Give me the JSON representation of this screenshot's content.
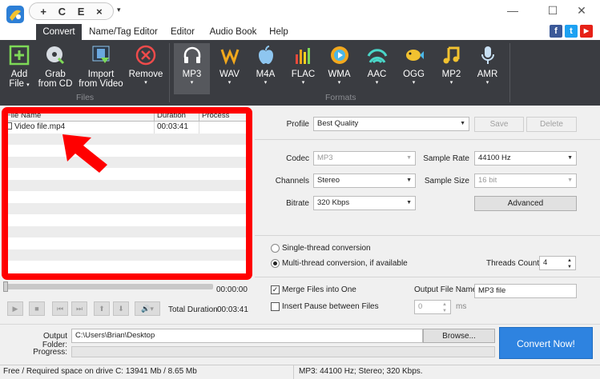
{
  "window": {
    "controls": [
      "—",
      "☐",
      "✕"
    ]
  },
  "quick_access": {
    "items": [
      "+",
      "C",
      "E",
      "×"
    ],
    "more": "▾"
  },
  "tabs": [
    "Convert",
    "Name/Tag Editor",
    "Editor",
    "Audio Book",
    "Help"
  ],
  "social": {
    "facebook": "f",
    "twitter": "t",
    "youtube": "▶"
  },
  "ribbon": {
    "files_group": "Files",
    "formats_group": "Formats",
    "add_file": [
      "Add",
      "File"
    ],
    "grab_from_cd": [
      "Grab",
      "from CD"
    ],
    "import_from_video": [
      "Import",
      "from Video"
    ],
    "remove": "Remove",
    "dropdown_arrow": "▾",
    "formats": [
      "MP3",
      "WAV",
      "M4A",
      "FLAC",
      "WMA",
      "AAC",
      "OGG",
      "MP2",
      "AMR"
    ]
  },
  "file_list": {
    "columns": [
      "File Name",
      "Duration",
      "Process"
    ],
    "rows": [
      {
        "name": "Video file.mp4",
        "duration": "00:03:41",
        "process": ""
      }
    ]
  },
  "settings": {
    "profile_label": "Profile",
    "profile_value": "Best Quality",
    "save_label": "Save",
    "delete_label": "Delete",
    "codec_label": "Codec",
    "codec_value": "MP3",
    "channels_label": "Channels",
    "channels_value": "Stereo",
    "bitrate_label": "Bitrate",
    "bitrate_value": "320 Kbps",
    "sample_rate_label": "Sample Rate",
    "sample_rate_value": "44100 Hz",
    "sample_size_label": "Sample Size",
    "sample_size_value": "16 bit",
    "advanced_label": "Advanced",
    "single_thread_label": "Single-thread conversion",
    "multi_thread_label": "Multi-thread conversion, if available",
    "threads_count_label": "Threads Count",
    "threads_count_value": "4",
    "merge_label": "Merge Files into One",
    "merge_checked": true,
    "insert_pause_label": "Insert Pause between Files",
    "insert_pause_checked": false,
    "output_file_name_label": "Output File Name",
    "output_file_name_value": "MP3 file",
    "pause_value": "0",
    "pause_unit": "ms"
  },
  "player": {
    "position": "00:00:00",
    "total_duration_label": "Total Duration",
    "total_duration_value": "00:03:41",
    "icons": [
      "▶",
      "■",
      "⏮",
      "⏭",
      "⬆",
      "⬇",
      "🔊▾"
    ]
  },
  "output": {
    "folder_label": "Output Folder:",
    "folder_value": "C:\\Users\\Brian\\Desktop",
    "browse_label": "Browse...",
    "progress_label": "Progress:",
    "convert_now_label": "Convert Now!"
  },
  "status": {
    "space": "Free / Required space on drive  C: 13941 Mb / 8.65 Mb",
    "format": "MP3: 44100  Hz; Stereo; 320 Kbps."
  },
  "colors": {
    "ribbon": "#3a3c41",
    "accent": "#2e83e0",
    "highlight": "#ff0000"
  }
}
